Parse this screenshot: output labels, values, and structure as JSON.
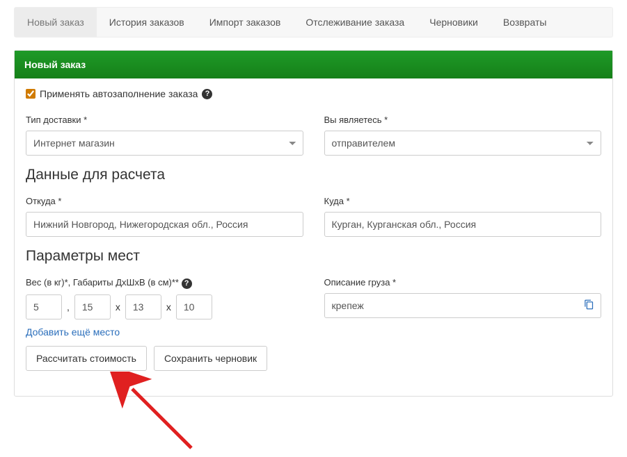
{
  "tabs": {
    "t0": "Новый заказ",
    "t1": "История заказов",
    "t2": "Импорт заказов",
    "t3": "Отслеживание заказа",
    "t4": "Черновики",
    "t5": "Возвраты"
  },
  "panel": {
    "title": "Новый заказ"
  },
  "autofill": {
    "label": "Применять автозаполнение заказа"
  },
  "delivery": {
    "type_label": "Тип доставки *",
    "type_value": "Интернет магазин",
    "role_label": "Вы являетесь *",
    "role_value": "отправителем"
  },
  "sections": {
    "calc": "Данные для расчета",
    "params": "Параметры мест"
  },
  "route": {
    "from_label": "Откуда *",
    "from_value": "Нижний Новгород, Нижегородская обл., Россия",
    "to_label": "Куда *",
    "to_value": "Курган, Курганская обл., Россия"
  },
  "dims": {
    "label": "Вес (в кг)*, Габариты ДхШхВ (в см)**",
    "weight": "5",
    "sep1": ",",
    "d": "15",
    "sepx1": "x",
    "w": "13",
    "sepx2": "x",
    "h": "10"
  },
  "cargo": {
    "desc_label": "Описание груза *",
    "desc_value": "крепеж"
  },
  "actions": {
    "add_place": "Добавить ещё место",
    "calc_btn": "Рассчитать стоимость",
    "draft_btn": "Сохранить черновик"
  }
}
